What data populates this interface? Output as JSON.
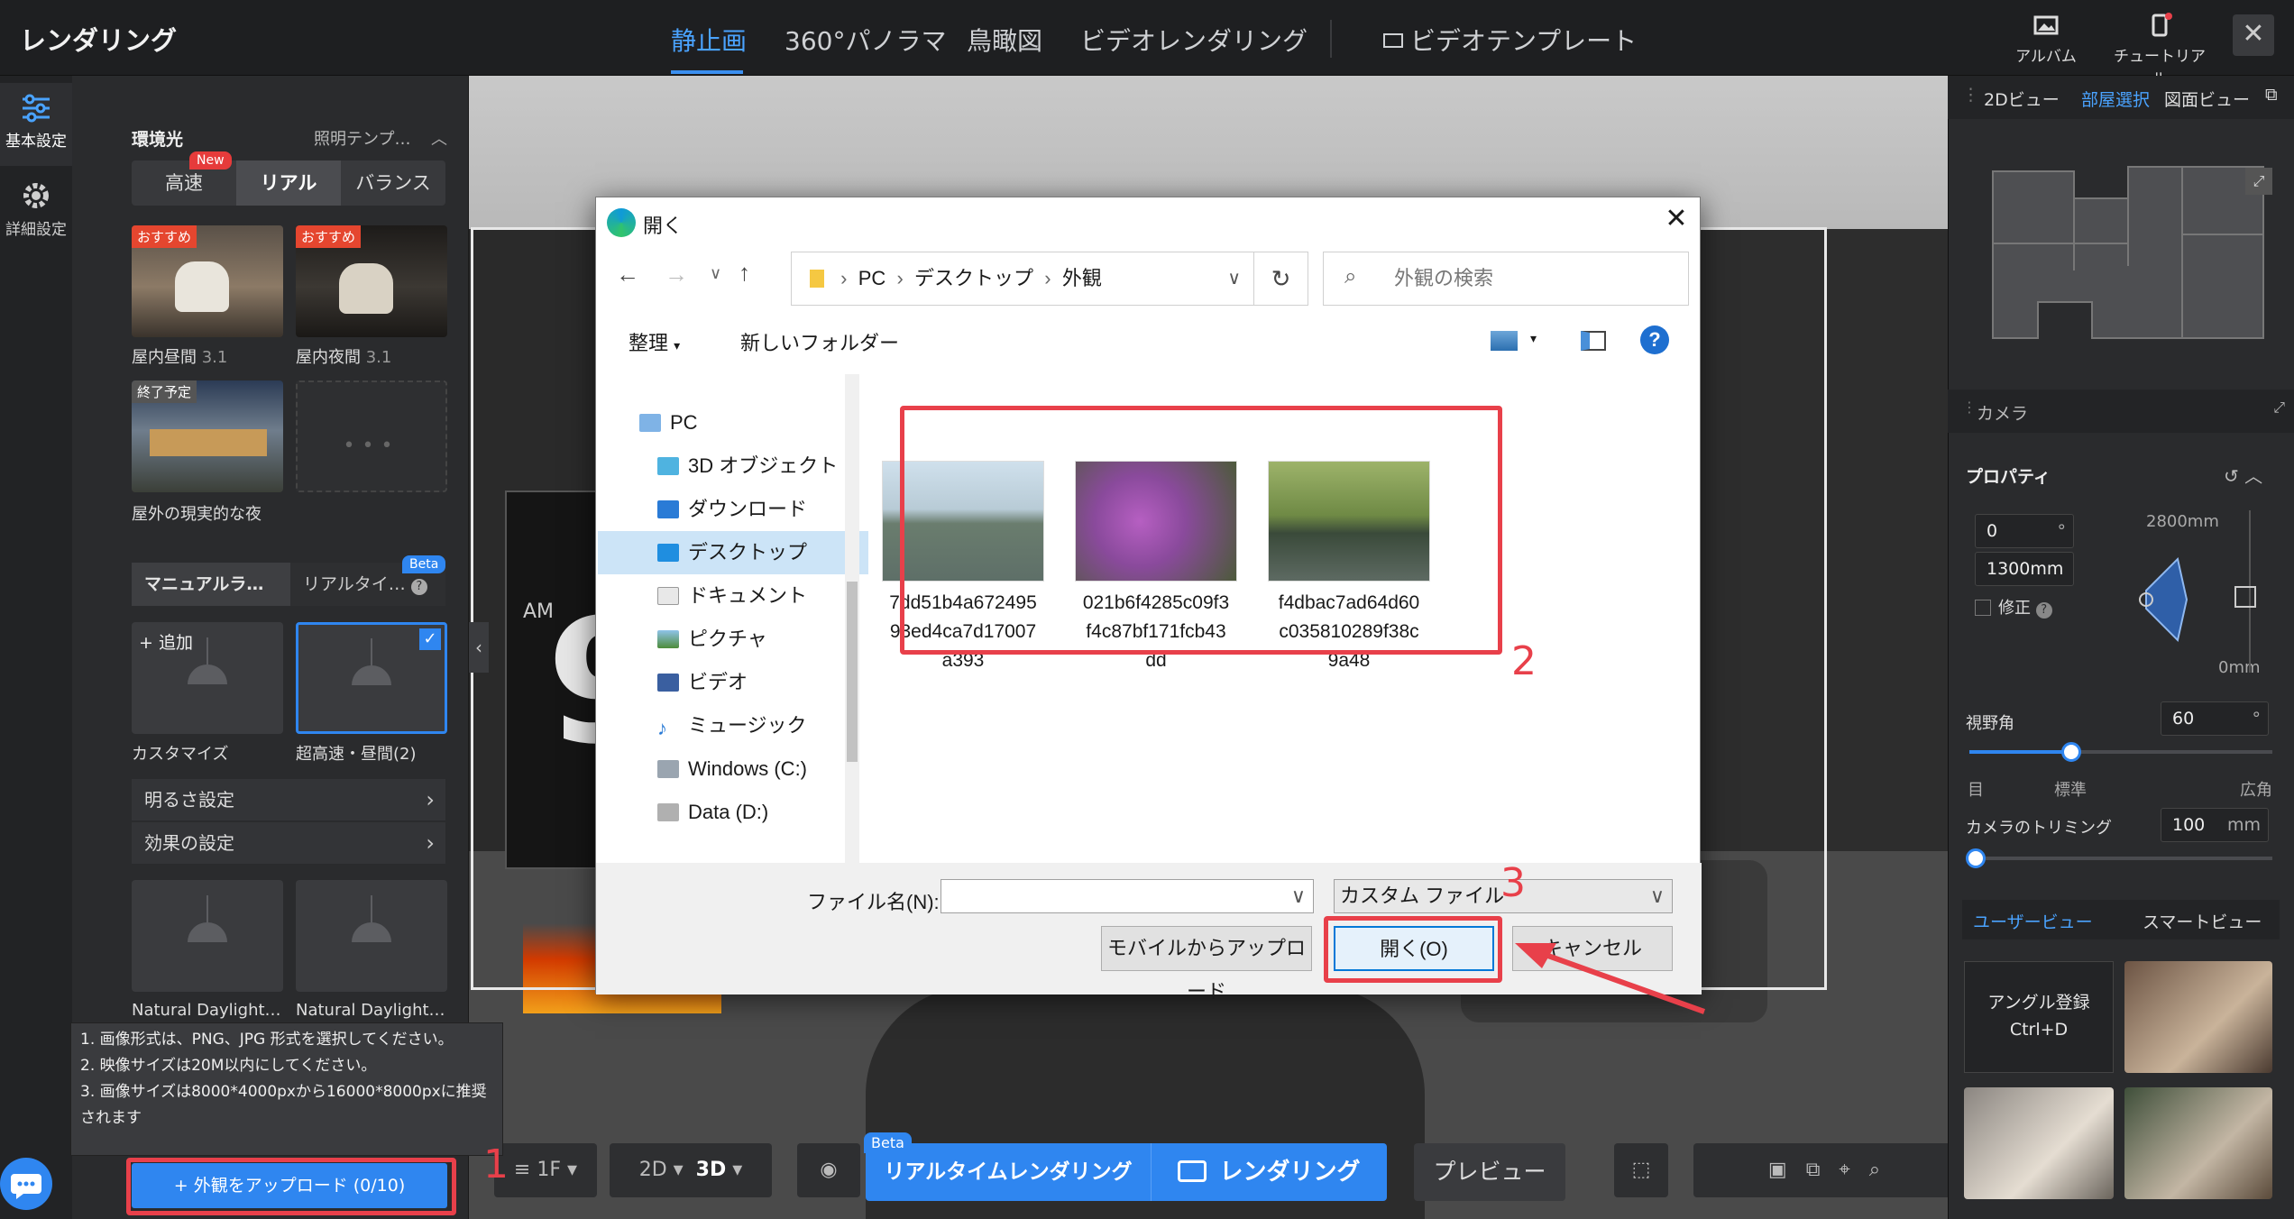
{
  "app": {
    "title": "レンダリング"
  },
  "top_nav": {
    "tabs": [
      "静止画",
      "360°パノラマ",
      "鳥瞰図",
      "ビデオレンダリング"
    ],
    "video_template": "ビデオテンプレート",
    "album": "アルバム",
    "tutorial": "チュートリアル"
  },
  "rail": {
    "basic": "基本設定",
    "advanced": "詳細設定"
  },
  "left": {
    "env_light": "環境光",
    "lighting_template": "照明テンプ…",
    "new_badge": "New",
    "quality": [
      "高速",
      "リアル",
      "バランス"
    ],
    "recommend": "おすすめ",
    "end_planned": "終了予定",
    "scenes": [
      {
        "name": "屋内昼間",
        "ver": "3.1"
      },
      {
        "name": "屋内夜間",
        "ver": "3.1"
      },
      {
        "name": "屋外の現実的な夜",
        "ver": ""
      }
    ],
    "manual_tab": "マニュアルラ…",
    "realtime_tab": "リアルタイ…",
    "beta": "Beta",
    "add": "+ 追加",
    "custom": "カスタマイズ",
    "ultra": "超高速・昼間(2)",
    "brightness": "明るさ設定",
    "effect": "効果の設定",
    "nd1": "Natural Daylight…",
    "nd2": "Natural Daylight…",
    "tooltip": "1. 画像形式は、PNG、JPG 形式を選択してください。\n2. 映像サイズは20M以内にしてください。\n3. 画像サイズは8000*4000pxから16000*8000pxに推奨されます",
    "upload_button": "+ 外観をアップロード (0/10)"
  },
  "annotations": {
    "n1": "1",
    "n2": "2",
    "n3": "3"
  },
  "viewport": {
    "clock_am": "AM",
    "clock_digit": "9"
  },
  "bottom": {
    "floor": "1F",
    "mode_2d": "2D",
    "mode_3d": "3D",
    "beta": "Beta",
    "realtime": "リアルタイムレンダリング",
    "render": "レンダリング",
    "preview": "プレビュー"
  },
  "right": {
    "tabs": [
      "2Dビュー",
      "部屋選択",
      "図面ビュー"
    ],
    "camera": "カメラ",
    "property": "プロパティ",
    "angle_value": "0",
    "angle_unit": "°",
    "height_value": "1300mm",
    "top_mm": "2800mm",
    "bottom_mm": "0mm",
    "fix": "修正",
    "fov_label": "視野角",
    "fov_value": "60",
    "fov_unit": "°",
    "fov_ticks": [
      "目",
      "標準",
      "広角"
    ],
    "trim_label": "カメラのトリミング",
    "trim_value": "100",
    "trim_unit": "mm",
    "view_tabs": [
      "ユーザービュー",
      "スマートビュー"
    ],
    "angle_register": "アングル登録",
    "shortcut": "Ctrl+D"
  },
  "dialog": {
    "title": "開く",
    "path": [
      "PC",
      "デスクトップ",
      "外観"
    ],
    "search_placeholder": "外観の検索",
    "organize": "整理",
    "new_folder": "新しいフォルダー",
    "help": "?",
    "tree": [
      "PC",
      "3D オブジェクト",
      "ダウンロード",
      "デスクトップ",
      "ドキュメント",
      "ピクチャ",
      "ビデオ",
      "ミュージック",
      "Windows (C:)",
      "Data (D:)"
    ],
    "files": [
      {
        "name": "7dd51b4a672495\n93ed4ca7d17007\na393"
      },
      {
        "name": "021b6f4285c09f3\nf4c87bf171fcb43\ndd"
      },
      {
        "name": "f4dbac7ad64d60\nc035810289f38c\n9a48"
      }
    ],
    "filename_label": "ファイル名(N):",
    "filetype": "カスタム ファイル",
    "mobile_upload": "モバイルからアップロード",
    "open": "開く(O)",
    "cancel": "キャンセル"
  },
  "colors": {
    "accent": "#2f86f0",
    "annotation": "#e8404a"
  }
}
